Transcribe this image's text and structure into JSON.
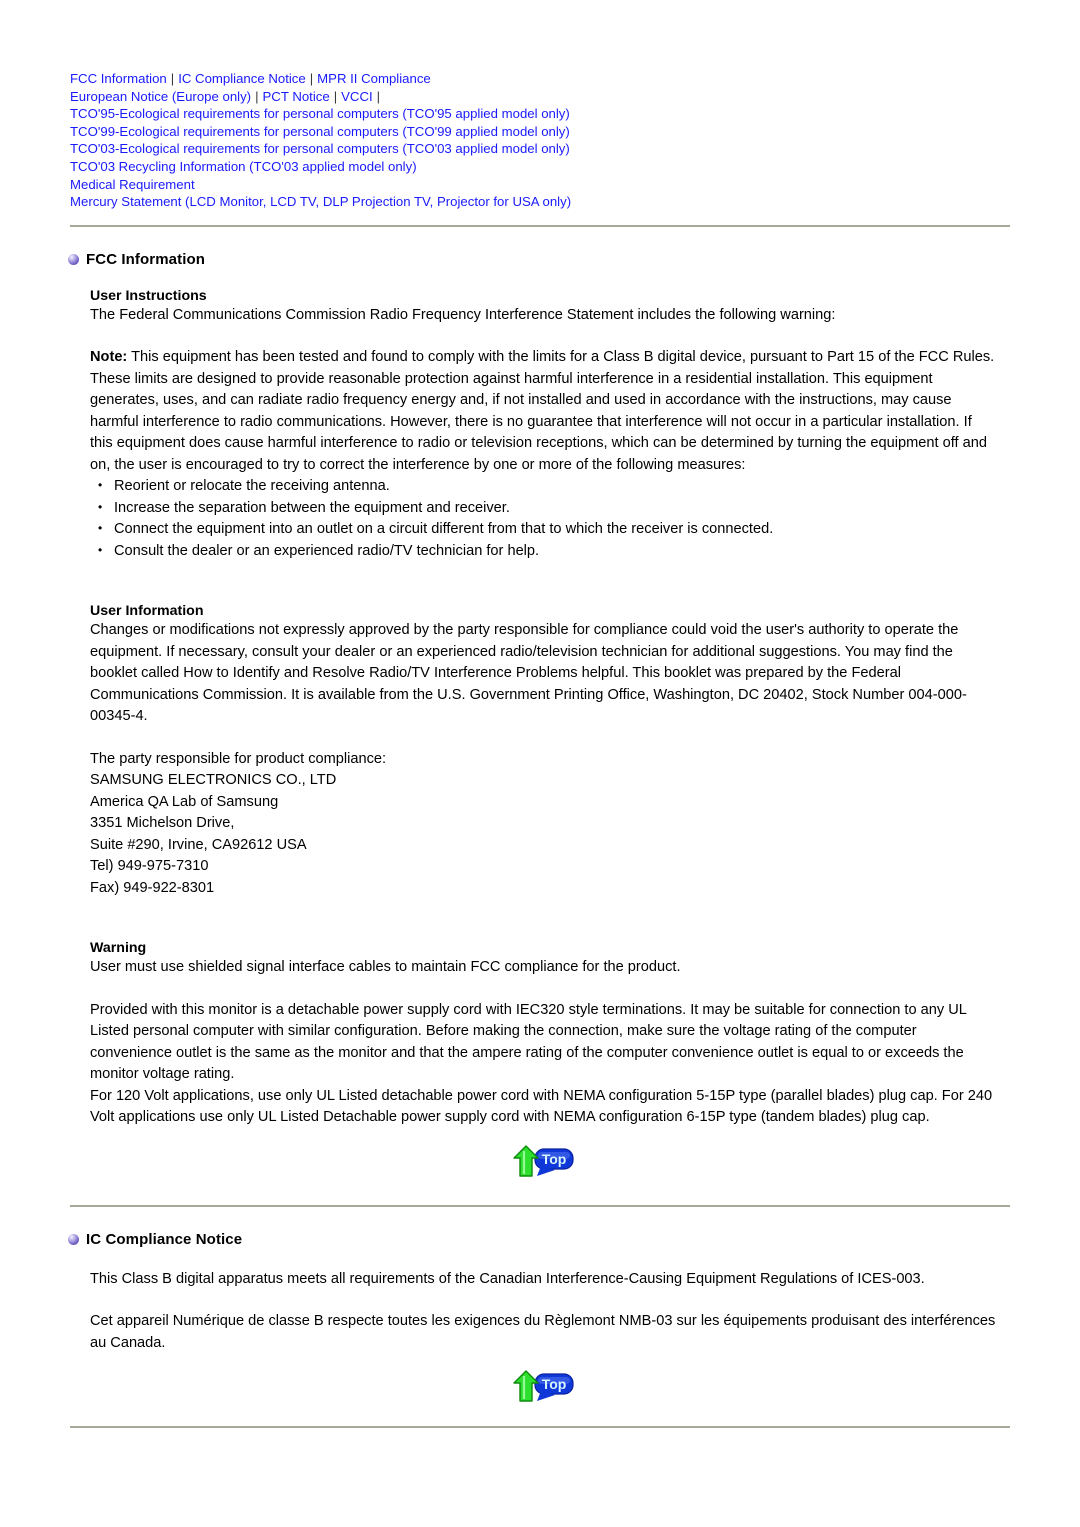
{
  "nav": {
    "rows": [
      {
        "items": [
          {
            "label": "FCC Information",
            "sep_after": true
          },
          {
            "label": "IC Compliance Notice",
            "sep_after": true
          },
          {
            "label": "MPR II Compliance",
            "sep_after": false
          }
        ]
      },
      {
        "items": [
          {
            "label": "European Notice (Europe only)",
            "sep_after": true
          },
          {
            "label": "PCT Notice",
            "sep_after": true
          },
          {
            "label": "VCCI",
            "sep_after": true
          }
        ]
      },
      {
        "items": [
          {
            "label": "TCO'95-Ecological requirements for personal computers (TCO'95 applied model only)",
            "sep_after": false
          }
        ]
      },
      {
        "items": [
          {
            "label": "TCO'99-Ecological requirements for personal computers (TCO'99 applied model only)",
            "sep_after": false
          }
        ]
      },
      {
        "items": [
          {
            "label": "TCO'03-Ecological requirements for personal computers (TCO'03 applied model only)",
            "sep_after": false
          }
        ]
      },
      {
        "items": [
          {
            "label": "TCO'03 Recycling Information (TCO'03 applied model only)",
            "sep_after": false
          }
        ]
      },
      {
        "items": [
          {
            "label": "Medical Requirement",
            "sep_after": false
          }
        ]
      },
      {
        "items": [
          {
            "label": "Mercury Statement (LCD Monitor, LCD TV, DLP Projection TV, Projector for USA only)",
            "sep_after": false
          }
        ]
      }
    ],
    "separator": "|",
    "link_color": "#1a1aff"
  },
  "sections": {
    "fcc": {
      "heading": "FCC Information",
      "user_instructions": {
        "heading": "User Instructions",
        "intro": "The Federal Communications Commission Radio Frequency Interference Statement includes the following warning:",
        "note_label": "Note:",
        "note_body": " This equipment has been tested and found to comply with the limits for a Class B digital device, pursuant to Part 15 of the FCC Rules. These limits are designed to provide reasonable protection against harmful interference in a residential installation. This equipment generates, uses, and can radiate radio frequency energy and, if not installed and used in accordance with the instructions, may cause harmful interference to radio communications. However, there is no guarantee that interference will not occur in a particular installation. If this equipment does cause harmful interference to radio or television receptions, which can be determined by turning the equipment off and on, the user is encouraged to try to correct the interference by one or more of the following measures:",
        "measures": [
          "Reorient or relocate the receiving antenna.",
          "Increase the separation between the equipment and receiver.",
          "Connect the equipment into an outlet on a circuit different from that to which the receiver is connected.",
          "Consult the dealer or an experienced radio/TV technician for help."
        ]
      },
      "user_information": {
        "heading": "User Information",
        "body": "Changes or modifications not expressly approved by the party responsible for compliance could void the user's authority to operate the equipment. If necessary, consult your dealer or an experienced radio/television technician for additional suggestions. You may find the booklet called How to Identify and Resolve Radio/TV Interference Problems helpful. This booklet was prepared by the Federal Communications Commission. It is available from the U.S. Government Printing Office, Washington, DC 20402, Stock Number 004-000-00345-4."
      },
      "responsible_party": {
        "intro": "The party responsible for product compliance:",
        "lines": [
          "SAMSUNG ELECTRONICS CO., LTD",
          "America QA Lab of Samsung",
          "3351 Michelson Drive,",
          "Suite #290, Irvine, CA92612 USA",
          "Tel) 949-975-7310",
          "Fax) 949-922-8301"
        ]
      },
      "warning": {
        "heading": "Warning",
        "body": "User must use shielded signal interface cables to maintain FCC compliance for the product.",
        "body2": "Provided with this monitor is a detachable power supply cord with IEC320 style terminations. It may be suitable for connection to any UL Listed personal computer with similar configuration. Before making the connection, make sure the voltage rating of the computer convenience outlet is the same as the monitor and that the ampere rating of the computer convenience outlet is equal to or exceeds the monitor voltage rating.",
        "body3": "For 120 Volt applications, use only UL Listed detachable power cord with NEMA configuration 5-15P type (parallel blades) plug cap. For 240 Volt applications use only UL Listed Detachable power supply cord with NEMA configuration 6-15P type (tandem blades) plug cap."
      }
    },
    "ic": {
      "heading": "IC Compliance Notice",
      "body_en": "This Class B digital apparatus meets all requirements of the Canadian Interference-Causing Equipment Regulations of ICES-003.",
      "body_fr": "Cet appareil Numérique de classe B respecte toutes les exigences du Règlemont NMB-03 sur les équipements produisant des interférences au Canada."
    }
  },
  "top_button": {
    "label": "Top",
    "arrow_color": "#2ee02e",
    "badge_color": "#1038d8"
  },
  "colors": {
    "rule": "#a8a898",
    "link": "#1a1aff",
    "bullet_sphere": "#6f5fc4",
    "text": "#000000"
  }
}
